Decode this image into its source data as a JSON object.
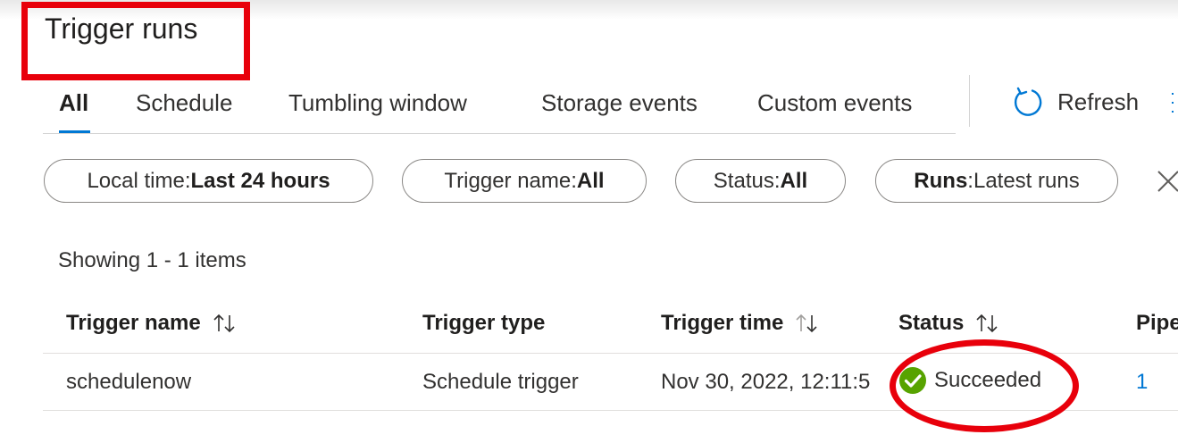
{
  "page": {
    "title": "Trigger runs"
  },
  "tabs": [
    {
      "label": "All",
      "active": true
    },
    {
      "label": "Schedule"
    },
    {
      "label": "Tumbling window"
    },
    {
      "label": "Storage events"
    },
    {
      "label": "Custom events"
    }
  ],
  "toolbar": {
    "refresh_label": "Refresh"
  },
  "filters": [
    {
      "label": "Local time",
      "sep": " : ",
      "value": "Last 24 hours"
    },
    {
      "label": "Trigger name",
      "sep": " : ",
      "value": "All"
    },
    {
      "label": "Status",
      "sep": " : ",
      "value": "All"
    },
    {
      "label": "Runs",
      "sep": " : ",
      "value": "Latest runs"
    }
  ],
  "summary": {
    "showing": "Showing 1 - 1 items"
  },
  "table": {
    "columns": [
      "Trigger name",
      "Trigger type",
      "Trigger time",
      "Status",
      "Pipe"
    ],
    "rows": [
      {
        "name": "schedulenow",
        "type": "Schedule trigger",
        "time": "Nov 30, 2022, 12:11:5",
        "status": "Succeeded",
        "pipelines": "1"
      }
    ]
  },
  "colors": {
    "accent": "#0078d4",
    "success": "#57a300",
    "annotation": "#e8000b"
  },
  "icons": {
    "refresh": "refresh-icon",
    "sort": "sort-arrows-icon",
    "status": "success-check-icon",
    "close": "close-icon"
  }
}
